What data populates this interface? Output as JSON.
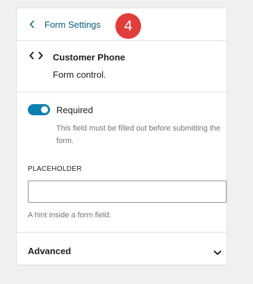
{
  "header": {
    "back_label": "Form Settings",
    "badge": "4"
  },
  "block": {
    "icon": "code-brackets-icon",
    "title": "Customer Phone",
    "description": "Form control."
  },
  "settings": {
    "required": {
      "label": "Required",
      "checked": true,
      "help": "This field must be filled out before submitting the form."
    },
    "placeholder": {
      "label": "PLACEHOLDER",
      "value": "",
      "help": "A hint inside a form field."
    }
  },
  "advanced": {
    "label": "Advanced",
    "expanded": false
  },
  "colors": {
    "accent": "#0a7fb0",
    "link": "#0a6080",
    "badge": "#e23d3d"
  }
}
